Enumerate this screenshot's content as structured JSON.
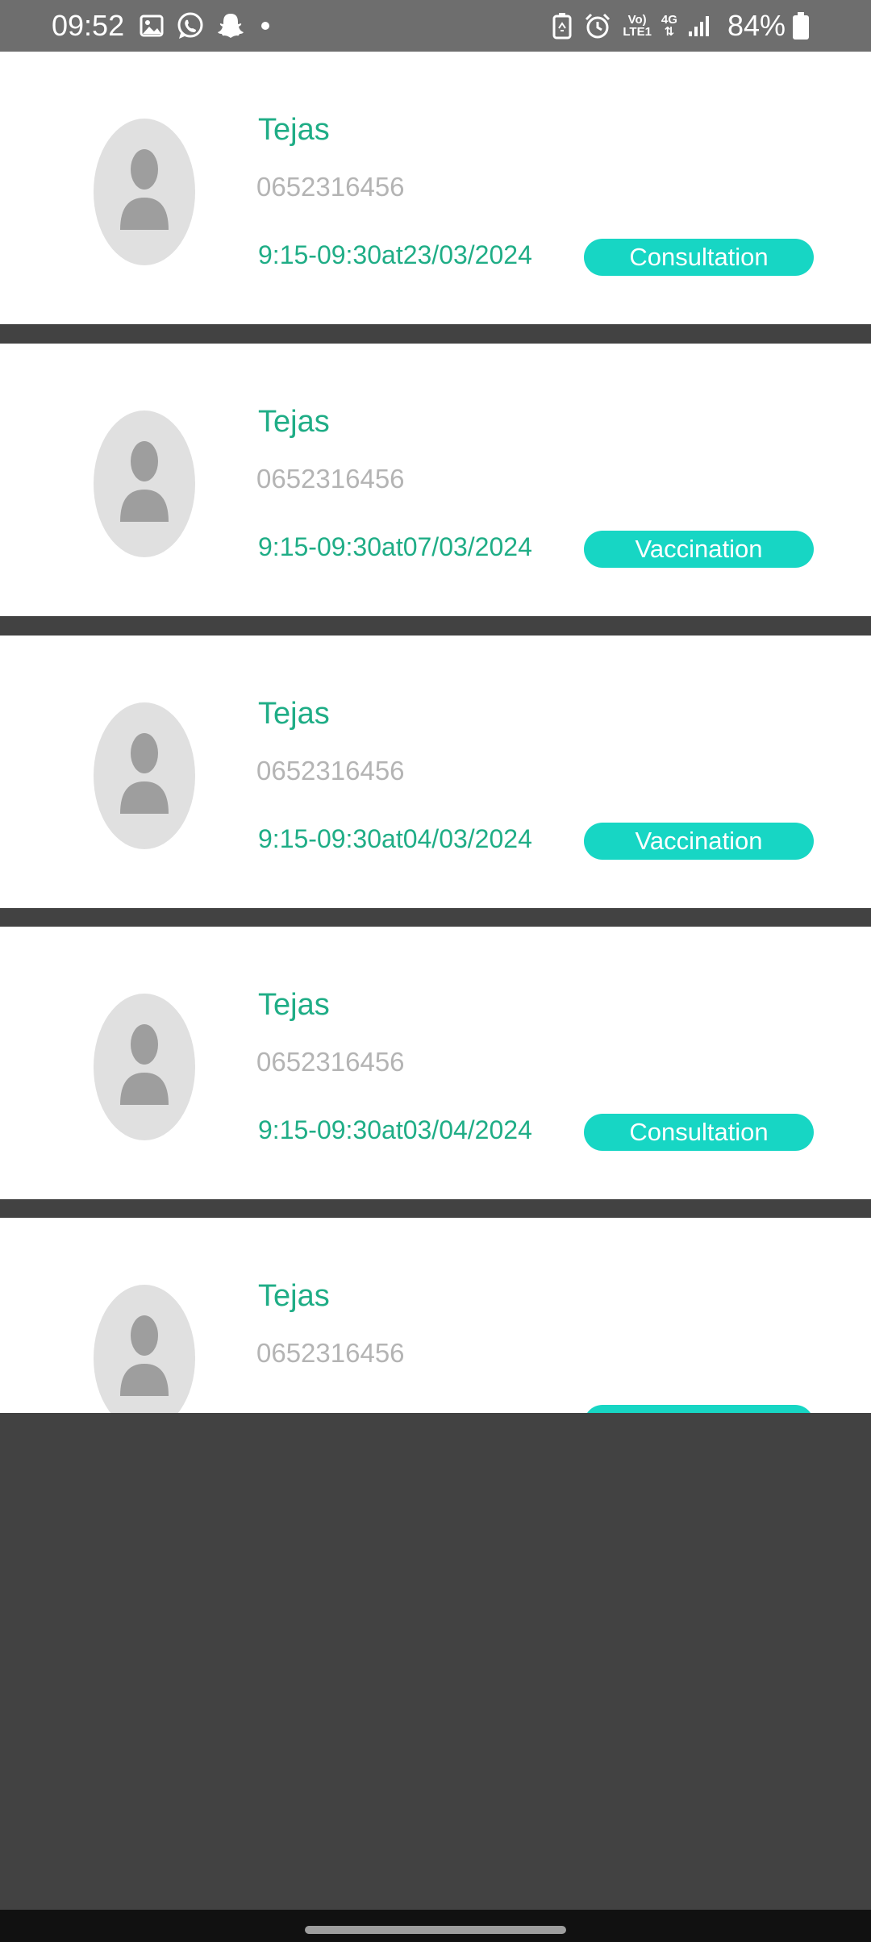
{
  "status_bar": {
    "time": "09:52",
    "network_top": "Vo)",
    "network_bottom": "LTE1",
    "network_gen": "4G",
    "battery_percent": "84%"
  },
  "appointments": [
    {
      "name": "Tejas",
      "phone": "0652316456",
      "slot": "9:15-09:30at23/03/2024",
      "type": "Consultation"
    },
    {
      "name": "Tejas",
      "phone": "0652316456",
      "slot": "9:15-09:30at07/03/2024",
      "type": "Vaccination"
    },
    {
      "name": "Tejas",
      "phone": "0652316456",
      "slot": "9:15-09:30at04/03/2024",
      "type": "Vaccination"
    },
    {
      "name": "Tejas",
      "phone": "0652316456",
      "slot": "9:15-09:30at03/04/2024",
      "type": "Consultation"
    },
    {
      "name": "Tejas",
      "phone": "0652316456",
      "slot": "",
      "type": ""
    }
  ],
  "colors": {
    "accent": "#1fad86",
    "badge": "#17d6c4",
    "muted_text": "#b4b4b4",
    "background": "#424242"
  }
}
